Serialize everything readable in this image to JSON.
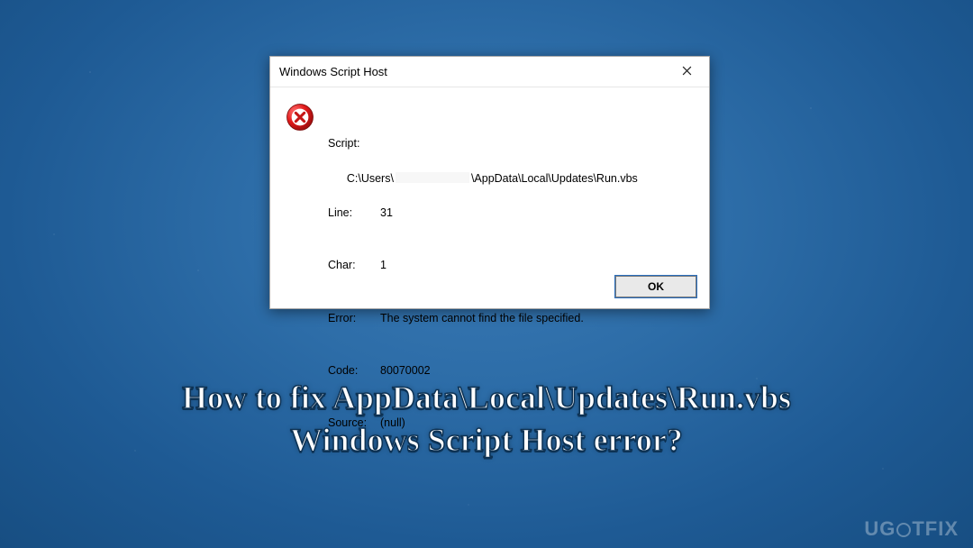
{
  "dialog": {
    "title": "Windows Script Host",
    "close_icon": "close",
    "error_icon": "error-circle-x",
    "script_label": "Script:",
    "script_path_prefix": "C:\\Users\\",
    "script_path_suffix": "\\AppData\\Local\\Updates\\Run.vbs",
    "rows": [
      {
        "label": "Line:",
        "value": "31"
      },
      {
        "label": "Char:",
        "value": "1"
      },
      {
        "label": "Error:",
        "value": "The system cannot find the file specified."
      },
      {
        "label": "Code:",
        "value": "80070002"
      },
      {
        "label": "Source:",
        "value": "(null)"
      }
    ],
    "ok_label": "OK"
  },
  "caption": {
    "line1": "How to fix AppData\\Local\\Updates\\Run.vbs",
    "line2": "Windows Script Host error?"
  },
  "watermark": {
    "pre": "UG",
    "post": "TFIX"
  }
}
